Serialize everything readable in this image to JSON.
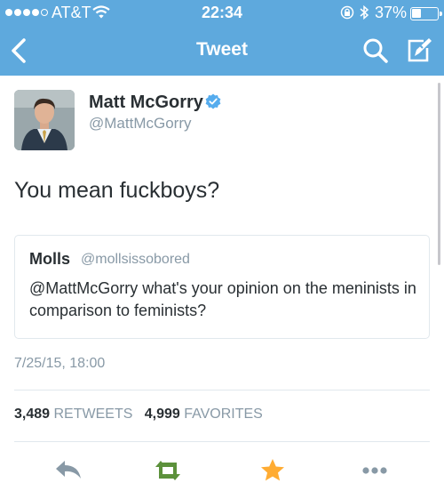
{
  "status_bar": {
    "carrier": "AT&T",
    "time": "22:34",
    "battery_percent": "37%",
    "battery_level": 0.37,
    "signal_bars_filled": 4,
    "signal_bars_total": 5
  },
  "nav": {
    "title": "Tweet",
    "back_icon": "chevron-left-icon",
    "search_icon": "search-icon",
    "compose_icon": "compose-icon"
  },
  "tweet": {
    "author_name": "Matt McGorry",
    "author_handle": "@MattMcGorry",
    "verified": true,
    "text": "You mean fuckboys?",
    "quoted": {
      "name": "Molls",
      "handle": "@mollsissobored",
      "text": "@MattMcGorry what's your opinion on the meninists in comparison to feminists?"
    },
    "timestamp": "7/25/15, 18:00",
    "retweets_count": "3,489",
    "retweets_label": "RETWEETS",
    "favorites_count": "4,999",
    "favorites_label": "FAVORITES"
  },
  "actions": [
    {
      "name": "reply-icon"
    },
    {
      "name": "retweet-icon"
    },
    {
      "name": "favorite-icon"
    },
    {
      "name": "more-icon"
    }
  ],
  "colors": {
    "header_blue": "#5ea9dd",
    "verified_blue": "#55acee",
    "retweet_green": "#5c913b",
    "favorite_orange": "#ffac33",
    "muted_gray": "#8899a6"
  }
}
